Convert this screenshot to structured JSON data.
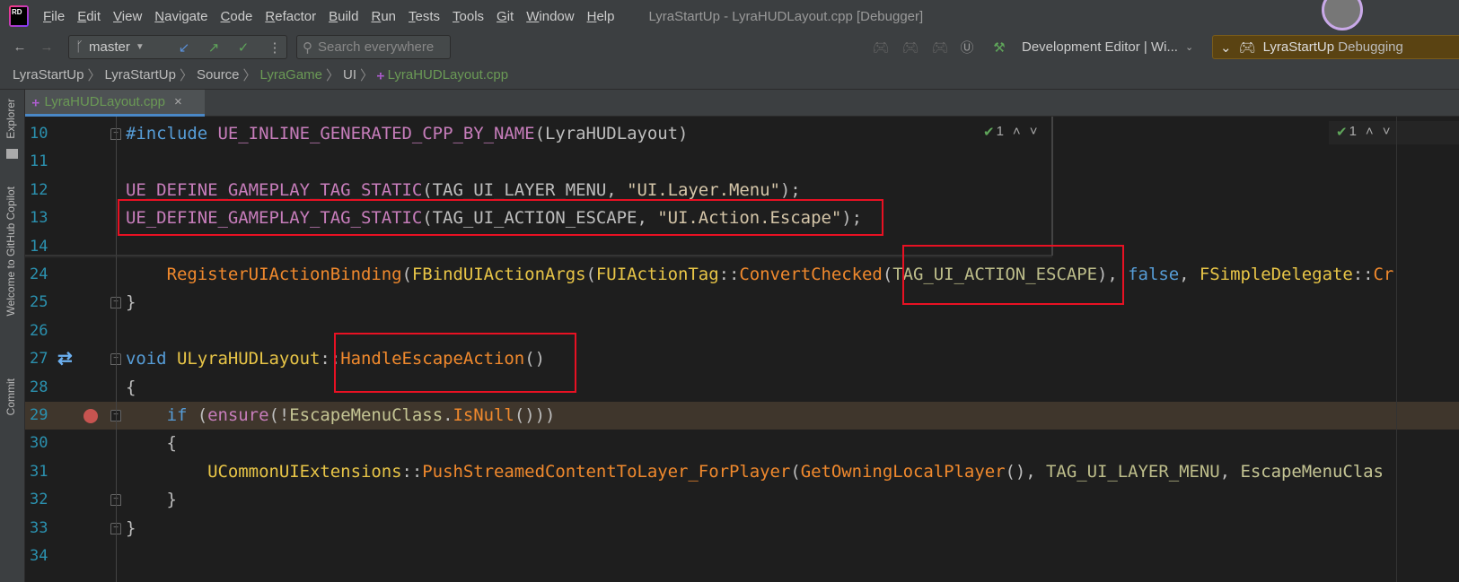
{
  "app": {
    "title": "LyraStartUp - LyraHUDLayout.cpp [Debugger]",
    "logo": "RD"
  },
  "menu": [
    "File",
    "Edit",
    "View",
    "Navigate",
    "Code",
    "Refactor",
    "Build",
    "Run",
    "Tests",
    "Tools",
    "Git",
    "Window",
    "Help"
  ],
  "toolbar": {
    "branch": "master",
    "search_placeholder": "Search everywhere",
    "config": "Development Editor | Wi...",
    "run_target": "LyraStartUp",
    "run_state": "Debugging"
  },
  "breadcrumb": [
    {
      "label": "LyraStartUp",
      "green": false
    },
    {
      "label": "LyraStartUp",
      "green": false
    },
    {
      "label": "Source",
      "green": false
    },
    {
      "label": "LyraGame",
      "green": true
    },
    {
      "label": "UI",
      "green": false
    },
    {
      "label": "LyraHUDLayout.cpp",
      "green": true
    }
  ],
  "tab": {
    "label": "LyraHUDLayout.cpp",
    "close": "×"
  },
  "sidebar": [
    "Explorer",
    "Welcome to GitHub Copilot",
    "Commit"
  ],
  "inspections": {
    "count": "1",
    "count_right": "1"
  },
  "colors": {
    "highlight_line": "#3f362c",
    "annotation_box": "#e81123",
    "line_numbers": "#2b91af"
  },
  "code_lines": [
    {
      "num": "10",
      "fold": true,
      "tokens": [
        [
          "#include ",
          "kw"
        ],
        [
          "UE_INLINE_GENERATED_CPP_BY_NAME",
          "mac"
        ],
        [
          "(",
          "pun"
        ],
        [
          "LyraHUDLayout",
          "pun"
        ],
        [
          ")",
          "pun"
        ]
      ]
    },
    {
      "num": "11",
      "tokens": []
    },
    {
      "num": "12",
      "tokens": [
        [
          "UE_DEFINE_GAMEPLAY_TAG_STATIC",
          "mac"
        ],
        [
          "(",
          "pun"
        ],
        [
          "TAG_UI_LAYER_MENU",
          "pun"
        ],
        [
          ", ",
          "pun"
        ],
        [
          "\"UI.Layer.Menu\"",
          "str"
        ],
        [
          ");",
          "pun"
        ]
      ]
    },
    {
      "num": "13",
      "tokens": [
        [
          "UE_DEFINE_GAMEPLAY_TAG_STATIC",
          "mac"
        ],
        [
          "(",
          "pun"
        ],
        [
          "TAG_UI_ACTION_ESCAPE",
          "pun"
        ],
        [
          ", ",
          "pun"
        ],
        [
          "\"UI.Action.Escape\"",
          "str"
        ],
        [
          ");",
          "pun"
        ]
      ]
    },
    {
      "num": "14",
      "tokens": []
    },
    {
      "num": "24",
      "tokens": [
        [
          "    ",
          "pun"
        ],
        [
          "RegisterUIActionBinding",
          "fn"
        ],
        [
          "(",
          "pun"
        ],
        [
          "FBindUIActionArgs",
          "cls"
        ],
        [
          "(",
          "pun"
        ],
        [
          "FUIActionTag",
          "cls"
        ],
        [
          "::",
          "pun"
        ],
        [
          "ConvertChecked",
          "fn"
        ],
        [
          "(",
          "pun"
        ],
        [
          "TAG_UI_ACTION_ESCAPE",
          "tag"
        ],
        [
          ")",
          "pun"
        ],
        [
          ", ",
          "pun"
        ],
        [
          "false",
          "kw"
        ],
        [
          ", ",
          "pun"
        ],
        [
          "FSimpleDelegate",
          "cls"
        ],
        [
          "::",
          "pun"
        ],
        [
          "Cr",
          "fn"
        ]
      ]
    },
    {
      "num": "25",
      "fold": true,
      "tokens": [
        [
          "}",
          "pun"
        ]
      ]
    },
    {
      "num": "26",
      "tokens": []
    },
    {
      "num": "27",
      "fold": true,
      "tokens": [
        [
          "void ",
          "kw"
        ],
        [
          "ULyraHUDLayout",
          "cls"
        ],
        [
          "::",
          "pun"
        ],
        [
          "HandleEscapeAction",
          "fn"
        ],
        [
          "()",
          "pun"
        ]
      ]
    },
    {
      "num": "28",
      "tokens": [
        [
          "{",
          "pun"
        ]
      ]
    },
    {
      "num": "29",
      "fold": true,
      "highlight": true,
      "breakpoint": true,
      "tokens": [
        [
          "    ",
          "pun"
        ],
        [
          "if ",
          "kw"
        ],
        [
          "(",
          "pun"
        ],
        [
          "ensure",
          "mac"
        ],
        [
          "(!",
          "pun"
        ],
        [
          "EscapeMenuClass",
          "fld"
        ],
        [
          ".",
          "pun"
        ],
        [
          "IsNull",
          "fn"
        ],
        [
          "()))",
          "pun"
        ]
      ]
    },
    {
      "num": "30",
      "tokens": [
        [
          "    {",
          "pun"
        ]
      ]
    },
    {
      "num": "31",
      "tokens": [
        [
          "        ",
          "pun"
        ],
        [
          "UCommonUIExtensions",
          "cls"
        ],
        [
          "::",
          "pun"
        ],
        [
          "PushStreamedContentToLayer_ForPlayer",
          "fn"
        ],
        [
          "(",
          "pun"
        ],
        [
          "GetOwningLocalPlayer",
          "fn"
        ],
        [
          "(), ",
          "pun"
        ],
        [
          "TAG_UI_LAYER_MENU",
          "tag"
        ],
        [
          ", ",
          "pun"
        ],
        [
          "EscapeMenuClas",
          "fld"
        ]
      ]
    },
    {
      "num": "32",
      "fold": true,
      "tokens": [
        [
          "    }",
          "pun"
        ]
      ]
    },
    {
      "num": "33",
      "fold": true,
      "tokens": [
        [
          "}",
          "pun"
        ]
      ]
    },
    {
      "num": "34",
      "tokens": []
    }
  ]
}
